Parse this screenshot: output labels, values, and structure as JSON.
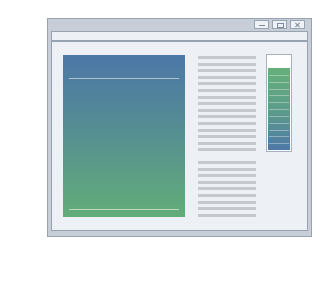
{
  "window": {
    "controls": {
      "minimize_icon": "minimize-icon",
      "maximize_icon": "maximize-icon",
      "close_icon": "close-icon"
    },
    "colors": {
      "frame": "#c7ced8",
      "border": "#97a3b1",
      "content_bg": "#edf0f4"
    }
  },
  "document": {
    "image": {
      "gradient_top": "#4c77a8",
      "gradient_bottom": "#62ad78"
    },
    "text_block_a_lines": 15,
    "text_block_b_lines": 9,
    "placeholder_line_color": "#c5c9ce"
  },
  "scroll_indicator": {
    "fill_fraction": 0.87,
    "fill_top_color": "#66b07a",
    "fill_bottom_color": "#4e78a8",
    "segments": 12
  }
}
